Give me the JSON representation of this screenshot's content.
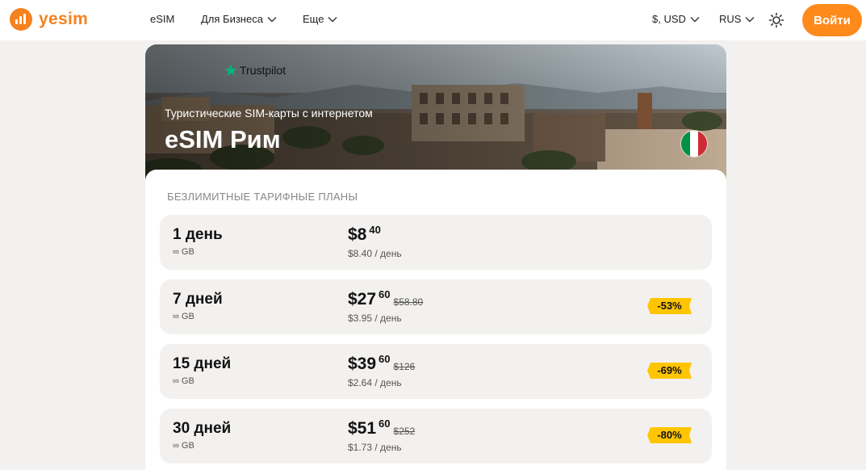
{
  "header": {
    "logo_text": "yesim",
    "nav": [
      {
        "label": "eSIM"
      },
      {
        "label": "Для Бизнеса"
      },
      {
        "label": "Еще"
      }
    ],
    "currency": "$, USD",
    "language": "RUS",
    "login_label": "Войти"
  },
  "hero": {
    "trustpilot": "Trustpilot",
    "subtitle": "Туристические SIM-карты с интернетом",
    "title": "eSIM Рим",
    "flag_colors": [
      "#009246",
      "#ffffff",
      "#ce2b37"
    ]
  },
  "plans_section": {
    "title": "БЕЗЛИМИТНЫЕ ТАРИФНЫЕ ПЛАНЫ",
    "plans": [
      {
        "name": "1 день",
        "data": "∞ GB",
        "price": "$8",
        "cents": "40",
        "old_price": "",
        "per_day": "$8.40 / день",
        "discount": ""
      },
      {
        "name": "7 дней",
        "data": "∞ GB",
        "price": "$27",
        "cents": "60",
        "old_price": "$58.80",
        "per_day": "$3.95 / день",
        "discount": "-53%"
      },
      {
        "name": "15 дней",
        "data": "∞ GB",
        "price": "$39",
        "cents": "60",
        "old_price": "$126",
        "per_day": "$2.64 / день",
        "discount": "-69%"
      },
      {
        "name": "30 дней",
        "data": "∞ GB",
        "price": "$51",
        "cents": "60",
        "old_price": "$252",
        "per_day": "$1.73 / день",
        "discount": "-80%"
      }
    ]
  },
  "colors": {
    "accent": "#ff8a1c",
    "badge": "#ffc500",
    "trustpilot_green": "#00b67a"
  }
}
